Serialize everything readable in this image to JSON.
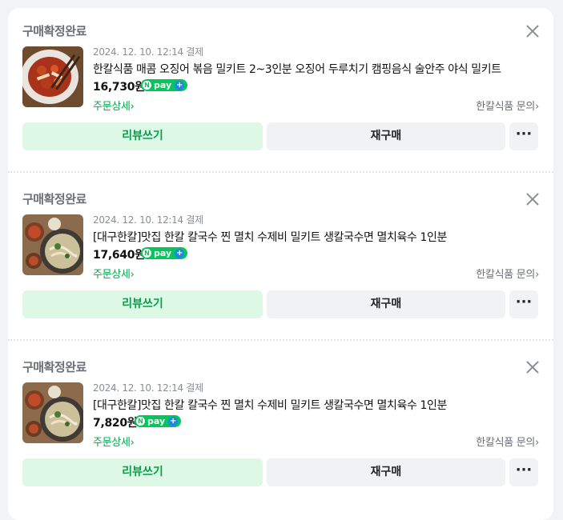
{
  "orders": [
    {
      "status": "구매확정완료",
      "date": "2024. 12. 10. 12:14 결제",
      "title": "한칼식품 매콤 오징어 볶음 밀키트 2~3인분 오징어 두루치기 캠핑음식 술안주 야식 밀키트",
      "price": "16,730원",
      "detail_label": "주문상세",
      "inquiry_label": "한칼식품 문의",
      "review_label": "리뷰쓰기",
      "rebuy_label": "재구매",
      "more_label": "···",
      "thumbnail": "squid-stirfry"
    },
    {
      "status": "구매확정완료",
      "date": "2024. 12. 10. 12:14 결제",
      "title": "[대구한칼]맛집 한칼 칼국수 찐 멸치 수제비 밀키트 생칼국수면 멸치육수 1인분",
      "price": "17,640원",
      "detail_label": "주문상세",
      "inquiry_label": "한칼식품 문의",
      "review_label": "리뷰쓰기",
      "rebuy_label": "재구매",
      "more_label": "···",
      "thumbnail": "kalguksu"
    },
    {
      "status": "구매확정완료",
      "date": "2024. 12. 10. 12:14 결제",
      "title": "[대구한칼]맛집 한칼 칼국수 찐 멸치 수제비 밀키트 생칼국수면 멸치육수 1인분",
      "price": "7,820원",
      "detail_label": "주문상세",
      "inquiry_label": "한칼식품 문의",
      "review_label": "리뷰쓰기",
      "rebuy_label": "재구매",
      "more_label": "···",
      "thumbnail": "kalguksu"
    }
  ],
  "npay": {
    "n": "N",
    "text": "pay",
    "plus": "+"
  },
  "colors": {
    "accent_green": "#03c75a",
    "review_bg": "#ddf8e4",
    "npay_plus": "#1e88e5"
  }
}
